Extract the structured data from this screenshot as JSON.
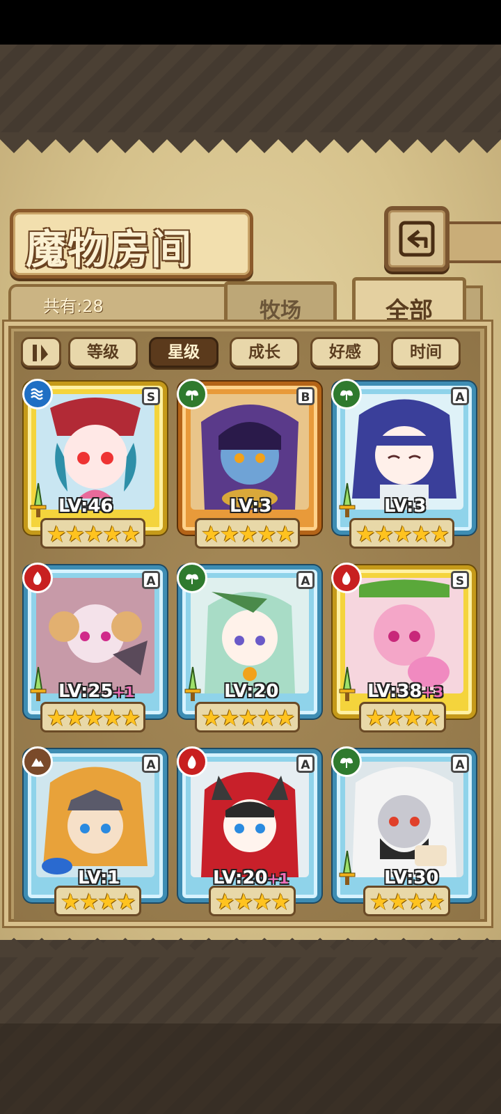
{
  "title": "魔物房间",
  "count_label": "共有:28",
  "tabs": {
    "farm": "牧场",
    "all": "全部"
  },
  "sort": {
    "level": "等级",
    "star": "星级",
    "growth": "成长",
    "affection": "好感",
    "time": "时间",
    "active": "star"
  },
  "colors": {
    "gold_frame": "#f4d43c",
    "bronze_frame": "#e89a3a",
    "blue_frame": "#8fd3ea",
    "star": "#ffc31f"
  },
  "monsters": [
    {
      "element": "water-icon",
      "rank": "S",
      "level": "LV:46",
      "plus": "",
      "stars": "★★★★★",
      "frame": "gold"
    },
    {
      "element": "leaf-icon",
      "rank": "B",
      "level": "LV:3",
      "plus": "",
      "stars": "★★★★★",
      "frame": "bronze"
    },
    {
      "element": "leaf-icon",
      "rank": "A",
      "level": "LV:3",
      "plus": "",
      "stars": "★★★★★",
      "frame": "blue"
    },
    {
      "element": "fire-icon",
      "rank": "A",
      "level": "LV:25",
      "plus": "+1",
      "stars": "★★★★★",
      "frame": "blue"
    },
    {
      "element": "leaf-icon",
      "rank": "A",
      "level": "LV:20",
      "plus": "",
      "stars": "★★★★★",
      "frame": "blue"
    },
    {
      "element": "fire-icon",
      "rank": "S",
      "level": "LV:38",
      "plus": "+3",
      "stars": "★★★★",
      "frame": "gold"
    },
    {
      "element": "earth-icon",
      "rank": "A",
      "level": "LV:1",
      "plus": "",
      "stars": "★★★★",
      "frame": "blue"
    },
    {
      "element": "fire-icon",
      "rank": "A",
      "level": "LV:20",
      "plus": "+1",
      "stars": "★★★★",
      "frame": "blue"
    },
    {
      "element": "leaf-icon",
      "rank": "A",
      "level": "LV:30",
      "plus": "",
      "stars": "★★★★",
      "frame": "blue"
    }
  ]
}
